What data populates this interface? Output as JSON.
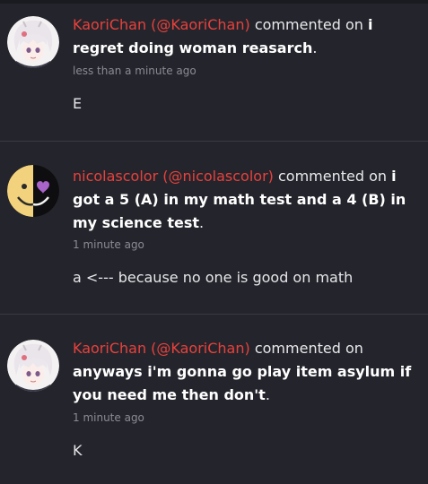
{
  "comments": [
    {
      "user": "KaoriChan (@KaoriChan)",
      "verb": "commented on",
      "title": "i regret doing woman reasarch",
      "time": "less than a minute ago",
      "body": "E",
      "avatar": "anime-girl-avatar"
    },
    {
      "user": "nicolascolor (@nicolascolor)",
      "verb": "commented on",
      "title": "i got a 5 (A) in my math test and a 4 (B) in my science test",
      "time": "1 minute ago",
      "body": "a <--- because no one is good on math",
      "avatar": "half-smiley-avatar"
    },
    {
      "user": "KaoriChan (@KaoriChan)",
      "verb": "commented on",
      "title": "anyways i'm gonna go play item asylum if you need me then don't",
      "time": "1 minute ago",
      "body": "K",
      "avatar": "anime-girl-avatar"
    }
  ],
  "colors": {
    "background": "#24252c",
    "username": "#e8413c",
    "timestamp": "#8a8b93",
    "divider": "#3a3b42"
  }
}
